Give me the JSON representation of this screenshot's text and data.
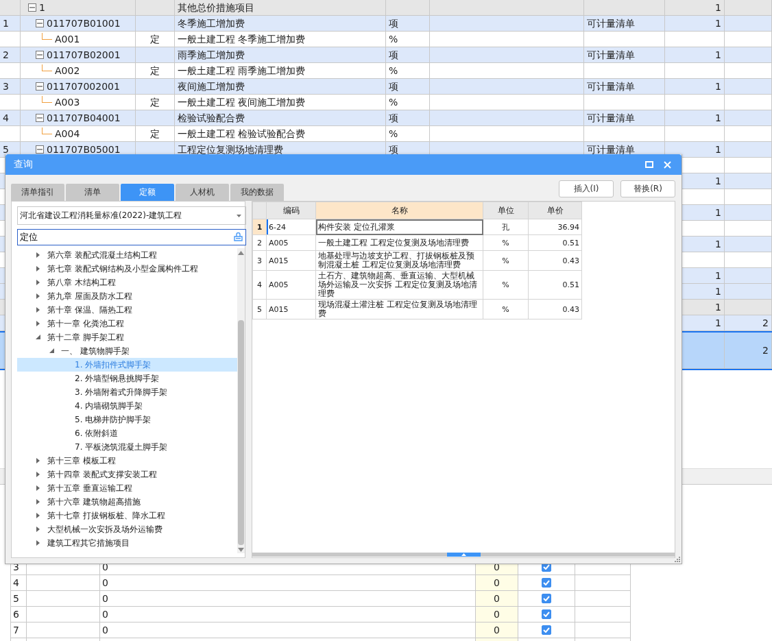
{
  "main_table": {
    "rows": [
      {
        "kind": "group",
        "selected": false,
        "expanded": true,
        "code": "1",
        "name": "其他总价措施项目",
        "qty": "1"
      },
      {
        "kind": "item",
        "selected": false,
        "expanded": true,
        "number": "1",
        "code": "011707B01001",
        "name": "冬季施工增加费",
        "unit": "项",
        "category": "可计量清单",
        "qty": "1"
      },
      {
        "kind": "sub",
        "selected": false,
        "code": "A001",
        "type": "定",
        "name": "一般土建工程 冬季施工增加费",
        "unit": "%"
      },
      {
        "kind": "item",
        "selected": false,
        "expanded": true,
        "number": "2",
        "code": "011707B02001",
        "name": "雨季施工增加费",
        "unit": "项",
        "category": "可计量清单",
        "qty": "1"
      },
      {
        "kind": "sub",
        "selected": false,
        "code": "A002",
        "type": "定",
        "name": "一般土建工程 雨季施工增加费",
        "unit": "%"
      },
      {
        "kind": "item",
        "selected": false,
        "expanded": true,
        "number": "3",
        "code": "011707002001",
        "name": "夜间施工增加费",
        "unit": "项",
        "category": "可计量清单",
        "qty": "1"
      },
      {
        "kind": "sub",
        "selected": false,
        "code": "A003",
        "type": "定",
        "name": "一般土建工程 夜间施工增加费",
        "unit": "%"
      },
      {
        "kind": "item",
        "selected": false,
        "expanded": true,
        "number": "4",
        "code": "011707B04001",
        "name": "检验试验配合费",
        "unit": "项",
        "category": "可计量清单",
        "qty": "1"
      },
      {
        "kind": "sub",
        "selected": false,
        "code": "A004",
        "type": "定",
        "name": "一般土建工程 检验试验配合费",
        "unit": "%"
      },
      {
        "kind": "item",
        "selected": false,
        "expanded": true,
        "number": "5",
        "code": "011707B05001",
        "name": "工程定位复测场地清理费",
        "unit": "项",
        "category": "可计量清单",
        "qty": "1"
      },
      {
        "kind": "sub",
        "selected": false
      },
      {
        "kind": "item",
        "selected": false,
        "qty": "1"
      },
      {
        "kind": "sub",
        "selected": false
      },
      {
        "kind": "item",
        "selected": false,
        "qty": "1"
      },
      {
        "kind": "sub",
        "selected": false
      },
      {
        "kind": "item",
        "selected": false,
        "qty": "1"
      },
      {
        "kind": "sub",
        "selected": false
      },
      {
        "kind": "item",
        "selected": false,
        "qty": "1"
      },
      {
        "kind": "item",
        "selected": false,
        "qty": "1"
      },
      {
        "kind": "group",
        "selected": false,
        "qty": "1"
      },
      {
        "kind": "item",
        "selected": false,
        "qty": "1",
        "column_9": "2"
      },
      {
        "kind": "item",
        "selected": true,
        "column_9": "2"
      }
    ]
  },
  "lower_table": {
    "rows": [
      {
        "number": "3",
        "value": "0",
        "amount": "0",
        "checked": true
      },
      {
        "number": "4",
        "value": "0",
        "amount": "0",
        "checked": true
      },
      {
        "number": "5",
        "value": "0",
        "amount": "0",
        "checked": true
      },
      {
        "number": "6",
        "value": "0",
        "amount": "0",
        "checked": true
      },
      {
        "number": "7",
        "value": "0",
        "amount": "0",
        "checked": true
      }
    ]
  },
  "dialog": {
    "title": "查询",
    "tabs": [
      {
        "label": "清单指引",
        "selected": false
      },
      {
        "label": "清单",
        "selected": false
      },
      {
        "label": "定额",
        "selected": true
      },
      {
        "label": "人材机",
        "selected": false
      },
      {
        "label": "我的数据",
        "selected": false
      }
    ],
    "buttons": [
      "插入(I)",
      "替换(R)"
    ],
    "library": "河北省建设工程消耗量标准(2022)-建筑工程",
    "search": {
      "value": "定位"
    },
    "tree": [
      {
        "label": "第六章 装配式混凝土结构工程",
        "expanded": false,
        "selected": false
      },
      {
        "label": "第七章 装配式钢结构及小型金属构件工程",
        "expanded": false,
        "selected": false
      },
      {
        "label": "第八章 木结构工程",
        "expanded": false,
        "selected": false
      },
      {
        "label": "第九章 屋面及防水工程",
        "expanded": false,
        "selected": false
      },
      {
        "label": "第十章 保温、隔热工程",
        "expanded": false,
        "selected": false
      },
      {
        "label": "第十一章 化粪池工程",
        "expanded": false,
        "selected": false
      },
      {
        "label": "第十二章 脚手架工程",
        "expanded": true,
        "selected": false,
        "children": [
          {
            "label": "一、 建筑物脚手架",
            "expanded": true,
            "selected": false,
            "children": [
              {
                "label": "1. 外墙扣件式脚手架",
                "selected": true
              },
              {
                "label": "2. 外墙型钢悬挑脚手架",
                "selected": false
              },
              {
                "label": "3. 外墙附着式升降脚手架",
                "selected": false
              },
              {
                "label": "4. 内墙砌筑脚手架",
                "selected": false
              },
              {
                "label": "5. 电梯井防护脚手架",
                "selected": false
              },
              {
                "label": "6. 依附斜道",
                "selected": false
              },
              {
                "label": "7. 平板浇筑混凝土脚手架",
                "selected": false
              }
            ]
          }
        ]
      },
      {
        "label": "第十三章 模板工程",
        "expanded": false,
        "selected": false
      },
      {
        "label": "第十四章 装配式支撑安装工程",
        "expanded": false,
        "selected": false
      },
      {
        "label": "第十五章 垂直运输工程",
        "expanded": false,
        "selected": false
      },
      {
        "label": "第十六章 建筑物超高措施",
        "expanded": false,
        "selected": false
      },
      {
        "label": "第十七章 打拔钢板桩、降水工程",
        "expanded": false,
        "selected": false
      },
      {
        "label": "大型机械一次安拆及场外运输费",
        "expanded": false,
        "selected": false
      },
      {
        "label": "建筑工程其它措施项目",
        "expanded": false,
        "selected": false
      }
    ],
    "results": {
      "columns": [
        {
          "label": "编码",
          "selected": false
        },
        {
          "label": "名称",
          "selected": true
        },
        {
          "label": "单位",
          "selected": false
        },
        {
          "label": "单价",
          "selected": false
        }
      ],
      "rows": [
        {
          "number": "1",
          "code": "6-24",
          "name": "构件安装 定位孔灌浆",
          "unit": "孔",
          "price": "36.94",
          "selected": true
        },
        {
          "number": "2",
          "code": "A005",
          "name": "一般土建工程 工程定位复测及场地清理费",
          "unit": "%",
          "price": "0.51",
          "selected": false
        },
        {
          "number": "3",
          "code": "A015",
          "name": "地基处理与边坡支护工程、打拔钢板桩及预制混凝土桩 工程定位复测及场地清理费",
          "unit": "%",
          "price": "0.43",
          "selected": false
        },
        {
          "number": "4",
          "code": "A005",
          "name": "土石方、建筑物超高、垂直运输、大型机械场外运输及一次安拆 工程定位复测及场地清理费",
          "unit": "%",
          "price": "0.51",
          "selected": false
        },
        {
          "number": "5",
          "code": "A015",
          "name": "现场混凝土灌注桩 工程定位复测及场地清理费",
          "unit": "%",
          "price": "0.43",
          "selected": false
        }
      ]
    }
  }
}
